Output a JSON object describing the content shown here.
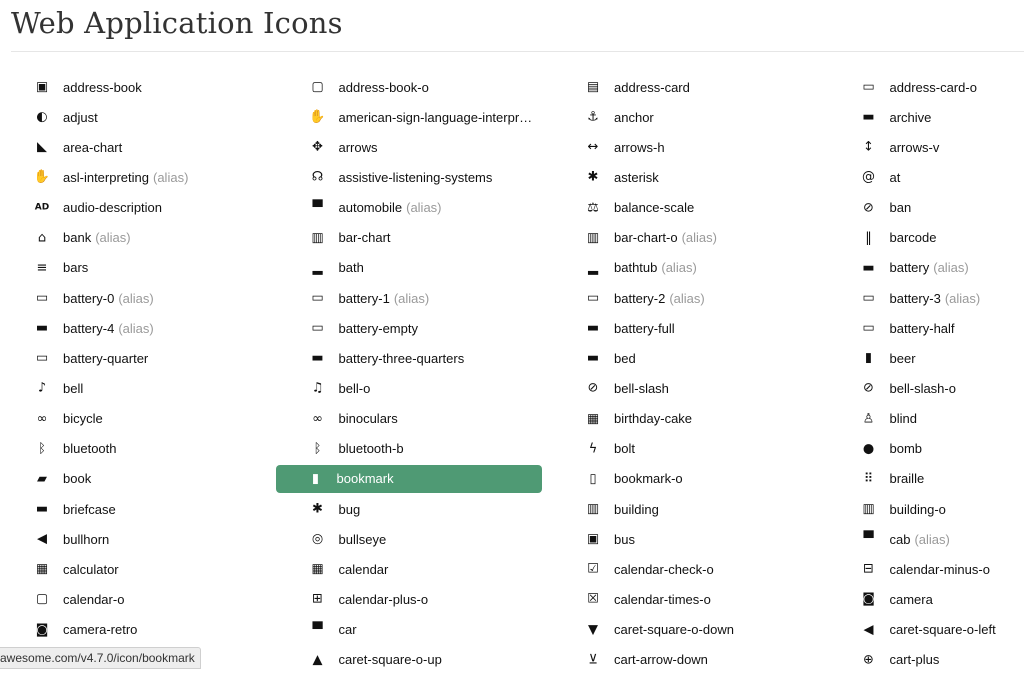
{
  "page": {
    "title": "Web Application Icons"
  },
  "alias_label": "(alias)",
  "accent_color": "#4f9a74",
  "active_icon": "bookmark",
  "status_url": "awesome.com/v4.7.0/icon/bookmark",
  "icons": [
    {
      "label": "address-book",
      "glyph": "▣"
    },
    {
      "label": "address-book-o",
      "glyph": "▢"
    },
    {
      "label": "address-card",
      "glyph": "▤"
    },
    {
      "label": "address-card-o",
      "glyph": "▭"
    },
    {
      "label": "adjust",
      "glyph": "◐"
    },
    {
      "label": "american-sign-language-interpr…",
      "glyph": "✋"
    },
    {
      "label": "anchor",
      "glyph": "⚓"
    },
    {
      "label": "archive",
      "glyph": "▬"
    },
    {
      "label": "area-chart",
      "glyph": "◣"
    },
    {
      "label": "arrows",
      "glyph": "✥"
    },
    {
      "label": "arrows-h",
      "glyph": "↔"
    },
    {
      "label": "arrows-v",
      "glyph": "↕"
    },
    {
      "label": "asl-interpreting",
      "alias": true,
      "glyph": "✋"
    },
    {
      "label": "assistive-listening-systems",
      "glyph": "☊"
    },
    {
      "label": "asterisk",
      "glyph": "✱"
    },
    {
      "label": "at",
      "glyph": "@"
    },
    {
      "label": "audio-description",
      "glyph": "AD"
    },
    {
      "label": "automobile",
      "alias": true,
      "glyph": "▀"
    },
    {
      "label": "balance-scale",
      "glyph": "⚖"
    },
    {
      "label": "ban",
      "glyph": "⊘"
    },
    {
      "label": "bank",
      "alias": true,
      "glyph": "⌂"
    },
    {
      "label": "bar-chart",
      "glyph": "▥"
    },
    {
      "label": "bar-chart-o",
      "alias": true,
      "glyph": "▥"
    },
    {
      "label": "barcode",
      "glyph": "‖"
    },
    {
      "label": "bars",
      "glyph": "≡"
    },
    {
      "label": "bath",
      "glyph": "▂"
    },
    {
      "label": "bathtub",
      "alias": true,
      "glyph": "▂"
    },
    {
      "label": "battery",
      "alias": true,
      "glyph": "▬"
    },
    {
      "label": "battery-0",
      "alias": true,
      "glyph": "▭"
    },
    {
      "label": "battery-1",
      "alias": true,
      "glyph": "▭"
    },
    {
      "label": "battery-2",
      "alias": true,
      "glyph": "▭"
    },
    {
      "label": "battery-3",
      "alias": true,
      "glyph": "▭"
    },
    {
      "label": "battery-4",
      "alias": true,
      "glyph": "▬"
    },
    {
      "label": "battery-empty",
      "glyph": "▭"
    },
    {
      "label": "battery-full",
      "glyph": "▬"
    },
    {
      "label": "battery-half",
      "glyph": "▭"
    },
    {
      "label": "battery-quarter",
      "glyph": "▭"
    },
    {
      "label": "battery-three-quarters",
      "glyph": "▬"
    },
    {
      "label": "bed",
      "glyph": "▬"
    },
    {
      "label": "beer",
      "glyph": "▮"
    },
    {
      "label": "bell",
      "glyph": "♪"
    },
    {
      "label": "bell-o",
      "glyph": "♫"
    },
    {
      "label": "bell-slash",
      "glyph": "⊘"
    },
    {
      "label": "bell-slash-o",
      "glyph": "⊘"
    },
    {
      "label": "bicycle",
      "glyph": "∞"
    },
    {
      "label": "binoculars",
      "glyph": "∞"
    },
    {
      "label": "birthday-cake",
      "glyph": "▦"
    },
    {
      "label": "blind",
      "glyph": "♙"
    },
    {
      "label": "bluetooth",
      "glyph": "ᛒ"
    },
    {
      "label": "bluetooth-b",
      "glyph": "ᛒ"
    },
    {
      "label": "bolt",
      "glyph": "ϟ"
    },
    {
      "label": "bomb",
      "glyph": "●"
    },
    {
      "label": "book",
      "glyph": "▰"
    },
    {
      "label": "bookmark",
      "glyph": "▮"
    },
    {
      "label": "bookmark-o",
      "glyph": "▯"
    },
    {
      "label": "braille",
      "glyph": "⠿"
    },
    {
      "label": "briefcase",
      "glyph": "▬"
    },
    {
      "label": "bug",
      "glyph": "✱"
    },
    {
      "label": "building",
      "glyph": "▥"
    },
    {
      "label": "building-o",
      "glyph": "▥"
    },
    {
      "label": "bullhorn",
      "glyph": "◀"
    },
    {
      "label": "bullseye",
      "glyph": "◎"
    },
    {
      "label": "bus",
      "glyph": "▣"
    },
    {
      "label": "cab",
      "alias": true,
      "glyph": "▀"
    },
    {
      "label": "calculator",
      "glyph": "▦"
    },
    {
      "label": "calendar",
      "glyph": "▦"
    },
    {
      "label": "calendar-check-o",
      "glyph": "☑"
    },
    {
      "label": "calendar-minus-o",
      "glyph": "⊟"
    },
    {
      "label": "calendar-o",
      "glyph": "▢"
    },
    {
      "label": "calendar-plus-o",
      "glyph": "⊞"
    },
    {
      "label": "calendar-times-o",
      "glyph": "☒"
    },
    {
      "label": "camera",
      "glyph": "◙"
    },
    {
      "label": "camera-retro",
      "glyph": "◙"
    },
    {
      "label": "car",
      "glyph": "▀"
    },
    {
      "label": "caret-square-o-down",
      "glyph": "▼"
    },
    {
      "label": "caret-square-o-left",
      "glyph": "◀"
    },
    {
      "label": "",
      "glyph": ""
    },
    {
      "label": "caret-square-o-up",
      "glyph": "▲"
    },
    {
      "label": "cart-arrow-down",
      "glyph": "⊻"
    },
    {
      "label": "cart-plus",
      "glyph": "⊕"
    }
  ]
}
